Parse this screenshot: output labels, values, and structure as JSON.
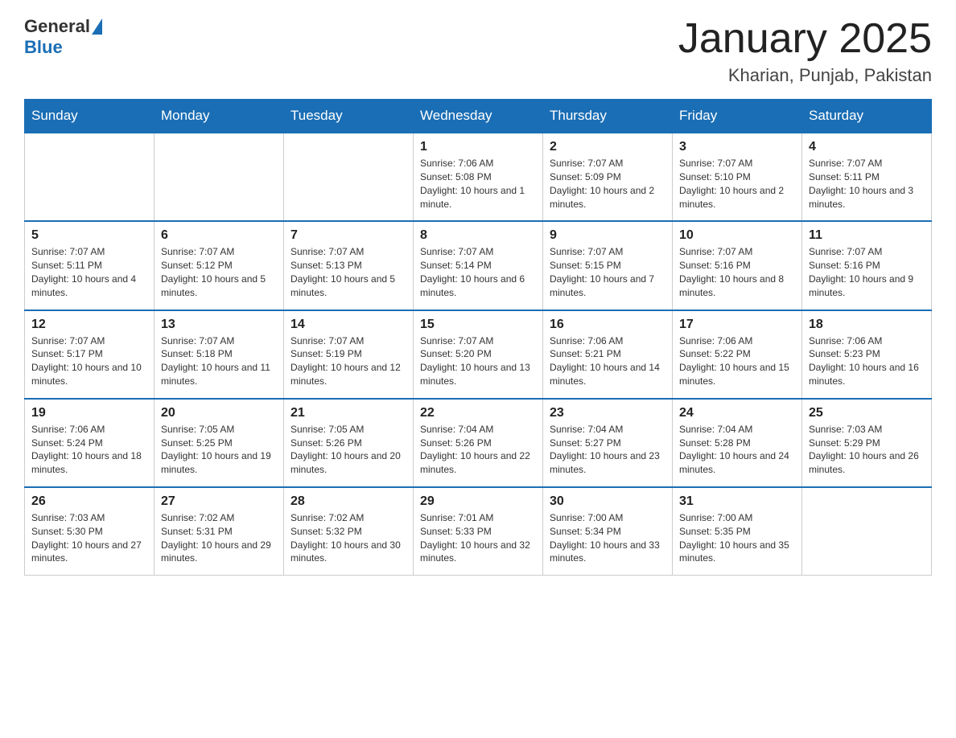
{
  "header": {
    "month_title": "January 2025",
    "location": "Kharian, Punjab, Pakistan"
  },
  "logo": {
    "text_general": "General",
    "text_blue": "Blue"
  },
  "days_of_week": [
    "Sunday",
    "Monday",
    "Tuesday",
    "Wednesday",
    "Thursday",
    "Friday",
    "Saturday"
  ],
  "weeks": [
    [
      {
        "day": "",
        "info": ""
      },
      {
        "day": "",
        "info": ""
      },
      {
        "day": "",
        "info": ""
      },
      {
        "day": "1",
        "info": "Sunrise: 7:06 AM\nSunset: 5:08 PM\nDaylight: 10 hours and 1 minute."
      },
      {
        "day": "2",
        "info": "Sunrise: 7:07 AM\nSunset: 5:09 PM\nDaylight: 10 hours and 2 minutes."
      },
      {
        "day": "3",
        "info": "Sunrise: 7:07 AM\nSunset: 5:10 PM\nDaylight: 10 hours and 2 minutes."
      },
      {
        "day": "4",
        "info": "Sunrise: 7:07 AM\nSunset: 5:11 PM\nDaylight: 10 hours and 3 minutes."
      }
    ],
    [
      {
        "day": "5",
        "info": "Sunrise: 7:07 AM\nSunset: 5:11 PM\nDaylight: 10 hours and 4 minutes."
      },
      {
        "day": "6",
        "info": "Sunrise: 7:07 AM\nSunset: 5:12 PM\nDaylight: 10 hours and 5 minutes."
      },
      {
        "day": "7",
        "info": "Sunrise: 7:07 AM\nSunset: 5:13 PM\nDaylight: 10 hours and 5 minutes."
      },
      {
        "day": "8",
        "info": "Sunrise: 7:07 AM\nSunset: 5:14 PM\nDaylight: 10 hours and 6 minutes."
      },
      {
        "day": "9",
        "info": "Sunrise: 7:07 AM\nSunset: 5:15 PM\nDaylight: 10 hours and 7 minutes."
      },
      {
        "day": "10",
        "info": "Sunrise: 7:07 AM\nSunset: 5:16 PM\nDaylight: 10 hours and 8 minutes."
      },
      {
        "day": "11",
        "info": "Sunrise: 7:07 AM\nSunset: 5:16 PM\nDaylight: 10 hours and 9 minutes."
      }
    ],
    [
      {
        "day": "12",
        "info": "Sunrise: 7:07 AM\nSunset: 5:17 PM\nDaylight: 10 hours and 10 minutes."
      },
      {
        "day": "13",
        "info": "Sunrise: 7:07 AM\nSunset: 5:18 PM\nDaylight: 10 hours and 11 minutes."
      },
      {
        "day": "14",
        "info": "Sunrise: 7:07 AM\nSunset: 5:19 PM\nDaylight: 10 hours and 12 minutes."
      },
      {
        "day": "15",
        "info": "Sunrise: 7:07 AM\nSunset: 5:20 PM\nDaylight: 10 hours and 13 minutes."
      },
      {
        "day": "16",
        "info": "Sunrise: 7:06 AM\nSunset: 5:21 PM\nDaylight: 10 hours and 14 minutes."
      },
      {
        "day": "17",
        "info": "Sunrise: 7:06 AM\nSunset: 5:22 PM\nDaylight: 10 hours and 15 minutes."
      },
      {
        "day": "18",
        "info": "Sunrise: 7:06 AM\nSunset: 5:23 PM\nDaylight: 10 hours and 16 minutes."
      }
    ],
    [
      {
        "day": "19",
        "info": "Sunrise: 7:06 AM\nSunset: 5:24 PM\nDaylight: 10 hours and 18 minutes."
      },
      {
        "day": "20",
        "info": "Sunrise: 7:05 AM\nSunset: 5:25 PM\nDaylight: 10 hours and 19 minutes."
      },
      {
        "day": "21",
        "info": "Sunrise: 7:05 AM\nSunset: 5:26 PM\nDaylight: 10 hours and 20 minutes."
      },
      {
        "day": "22",
        "info": "Sunrise: 7:04 AM\nSunset: 5:26 PM\nDaylight: 10 hours and 22 minutes."
      },
      {
        "day": "23",
        "info": "Sunrise: 7:04 AM\nSunset: 5:27 PM\nDaylight: 10 hours and 23 minutes."
      },
      {
        "day": "24",
        "info": "Sunrise: 7:04 AM\nSunset: 5:28 PM\nDaylight: 10 hours and 24 minutes."
      },
      {
        "day": "25",
        "info": "Sunrise: 7:03 AM\nSunset: 5:29 PM\nDaylight: 10 hours and 26 minutes."
      }
    ],
    [
      {
        "day": "26",
        "info": "Sunrise: 7:03 AM\nSunset: 5:30 PM\nDaylight: 10 hours and 27 minutes."
      },
      {
        "day": "27",
        "info": "Sunrise: 7:02 AM\nSunset: 5:31 PM\nDaylight: 10 hours and 29 minutes."
      },
      {
        "day": "28",
        "info": "Sunrise: 7:02 AM\nSunset: 5:32 PM\nDaylight: 10 hours and 30 minutes."
      },
      {
        "day": "29",
        "info": "Sunrise: 7:01 AM\nSunset: 5:33 PM\nDaylight: 10 hours and 32 minutes."
      },
      {
        "day": "30",
        "info": "Sunrise: 7:00 AM\nSunset: 5:34 PM\nDaylight: 10 hours and 33 minutes."
      },
      {
        "day": "31",
        "info": "Sunrise: 7:00 AM\nSunset: 5:35 PM\nDaylight: 10 hours and 35 minutes."
      },
      {
        "day": "",
        "info": ""
      }
    ]
  ]
}
